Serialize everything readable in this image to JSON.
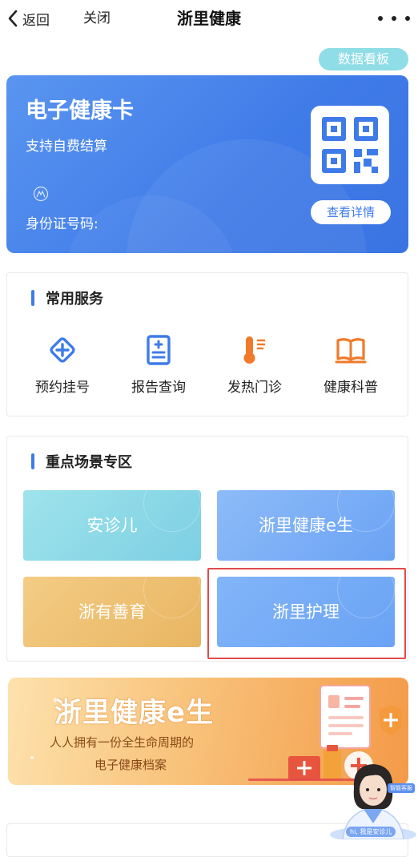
{
  "nav": {
    "back_label": "返回",
    "close_label": "关闭",
    "title": "浙里健康"
  },
  "dashboard_button": "数据看板",
  "health_card": {
    "title": "电子健康卡",
    "subtitle": "支持自费结算",
    "id_label": "身份证号码:",
    "detail_button": "查看详情",
    "color": "#3f7be8"
  },
  "common_services": {
    "title": "常用服务",
    "items": [
      {
        "label": "预约挂号",
        "icon": "plus-diamond-icon"
      },
      {
        "label": "报告查询",
        "icon": "report-icon"
      },
      {
        "label": "发热门诊",
        "icon": "thermometer-icon"
      },
      {
        "label": "健康科普",
        "icon": "book-icon"
      }
    ]
  },
  "key_scenes": {
    "title": "重点场景专区",
    "tiles": [
      {
        "label": "安诊儿"
      },
      {
        "label": "浙里健康e生"
      },
      {
        "label": "浙有善育"
      },
      {
        "label": "浙里护理"
      }
    ]
  },
  "banner": {
    "title": "浙里健康e生",
    "subtitle_line1": "人人拥有一份全生命周期的",
    "subtitle_line2": "电子健康档案"
  },
  "assistant": {
    "tag": "智能客服",
    "greeting": "hi, 我是安诊儿"
  },
  "colors": {
    "accent": "#3f7be8",
    "highlight": "#e24a4a",
    "service_icon_blue": "#3f7be8",
    "service_icon_orange": "#f07a2a"
  }
}
